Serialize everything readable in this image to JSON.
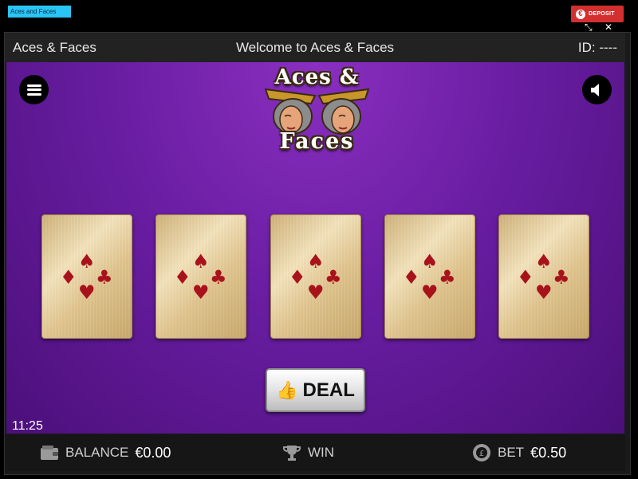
{
  "browser": {
    "tab_label": "Aces and Faces",
    "deposit_label": "DEPOSIT",
    "fullscreen_glyph": "⤡",
    "close_glyph": "✕"
  },
  "header": {
    "game_name": "Aces & Faces",
    "welcome": "Welcome to Aces & Faces",
    "id_label": "ID: ----"
  },
  "logo": {
    "line1": "Aces &",
    "line2": "Faces"
  },
  "cards": [
    {
      "state": "face-down"
    },
    {
      "state": "face-down"
    },
    {
      "state": "face-down"
    },
    {
      "state": "face-down"
    },
    {
      "state": "face-down"
    }
  ],
  "card_back_suits": [
    "♠",
    "♦",
    "♣",
    "♥"
  ],
  "controls": {
    "deal_label": "DEAL",
    "menu_icon": "hamburger-icon",
    "sound_icon": "speaker-icon"
  },
  "clock": "11:25",
  "footer": {
    "balance_label": "BALANCE",
    "balance_value": "€0.00",
    "win_label": "WIN",
    "bet_label": "BET",
    "bet_value": "€0.50"
  },
  "colors": {
    "felt": "#6a1ea3",
    "deposit": "#d32f2f",
    "suit_red": "#a8121b",
    "tab_tag": "#29c5f6"
  }
}
